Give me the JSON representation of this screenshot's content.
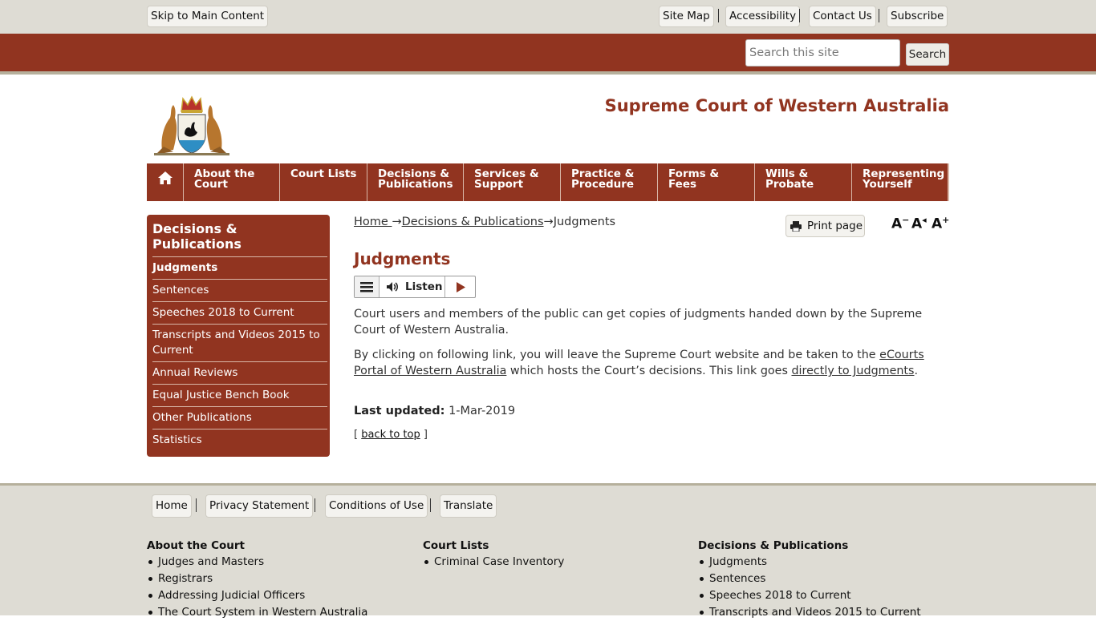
{
  "utility": {
    "skip": "Skip to Main Content",
    "links": [
      "Site Map",
      "Accessibility",
      "Contact Us",
      "Subscribe"
    ]
  },
  "search": {
    "placeholder": "Search this site",
    "button": "Search"
  },
  "site_title": "Supreme Court of Western Australia",
  "nav": [
    {
      "l1": "About the",
      "l2": "Court"
    },
    {
      "l1": "Court Lists",
      "l2": ""
    },
    {
      "l1": "Decisions &",
      "l2": "Publications"
    },
    {
      "l1": "Services &",
      "l2": "Support"
    },
    {
      "l1": "Practice &",
      "l2": "Procedure"
    },
    {
      "l1": "Forms &",
      "l2": "Fees"
    },
    {
      "l1": "Wills &",
      "l2": "Probate"
    },
    {
      "l1": "Representing",
      "l2": "Yourself"
    }
  ],
  "sidebar": {
    "heading": "Decisions & Publications",
    "items": [
      "Judgments",
      "Sentences",
      "Speeches 2018 to Current",
      "Transcripts and Videos 2015 to Current",
      "Annual Reviews",
      "Equal Justice Bench Book",
      "Other Publications",
      "Statistics"
    ]
  },
  "breadcrumb": {
    "home": "Home ",
    "arrow": "→",
    "section": "Decisions & Publications",
    "current": "Judgments"
  },
  "print_label": "Print page",
  "resize": {
    "decrease": "A",
    "reset": "A",
    "increase": "A"
  },
  "page_title": "Judgments",
  "listen_label": "Listen",
  "content": {
    "p1": "Court users and members of the public can get copies of judgments handed down by the Supreme Court of Western Australia.",
    "p2_a": "By clicking on following link, you will leave the Supreme Court website and be taken to the ",
    "p2_link1": "eCourts Portal of Western Australia",
    "p2_b": " which hosts the Court’s decisions. This link goes ",
    "p2_link2": "directly to Judgments",
    "p2_c": "."
  },
  "last_updated": {
    "label": "Last updated:",
    "value": "1-Mar-2019"
  },
  "back_to_top": {
    "open": "[ ",
    "link": "back to top",
    "close": " ]"
  },
  "footer": {
    "links": [
      "Home",
      "Privacy Statement",
      "Conditions of Use",
      "Translate"
    ],
    "columns": [
      {
        "heading": "About the Court",
        "items": [
          "Judges and Masters",
          "Registrars",
          "Addressing Judicial Officers",
          "The Court System in Western Australia"
        ]
      },
      {
        "heading": "Court Lists",
        "items": [
          "Criminal Case Inventory"
        ]
      },
      {
        "heading": "Decisions & Publications",
        "items": [
          "Judgments",
          "Sentences",
          "Speeches 2018 to Current",
          "Transcripts and Videos 2015 to Current"
        ]
      }
    ]
  },
  "colors": {
    "brand": "#913420",
    "band": "#dedcd4"
  }
}
